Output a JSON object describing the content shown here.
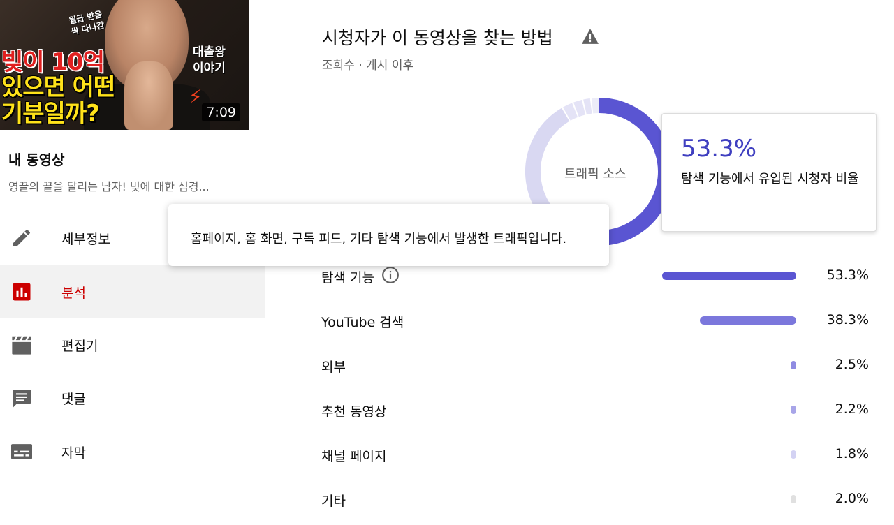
{
  "sidebar": {
    "thumbnail": {
      "overlay_red": "빚이 10억",
      "overlay_yellow_1": "있으면 어떤",
      "overlay_yellow_2": "기분일까?",
      "overlay_side": "대출왕\n이야기",
      "overlay_small": "월급 받음\n싹 다나감",
      "duration": "7:09"
    },
    "video_title": "내 동영상",
    "video_desc": "영끌의 끝을 달리는 남자! 빚에 대한 심경...",
    "nav": [
      {
        "label": "세부정보",
        "icon": "pencil-icon",
        "active": false
      },
      {
        "label": "분석",
        "icon": "analytics-icon",
        "active": true
      },
      {
        "label": "편집기",
        "icon": "clapperboard-icon",
        "active": false
      },
      {
        "label": "댓글",
        "icon": "comment-icon",
        "active": false
      },
      {
        "label": "자막",
        "icon": "subtitles-icon",
        "active": false
      }
    ]
  },
  "main": {
    "title": "시청자가 이 동영상을 찾는 방법",
    "subtitle": "조회수 · 게시 이후",
    "donut_label": "트래픽 소스",
    "tooltip": "홈페이지, 홈 화면, 구독 피드, 기타 탐색 기능에서 발생한 트래픽입니다.",
    "card": {
      "value": "53.3%",
      "desc": "탐색 기능에서 유입된 시청자 비율"
    },
    "colors": {
      "accent": "#5a55d2",
      "accent_2": "#7b77dc",
      "donut_rest": "#d9d8f2",
      "red_active": "#cc0000"
    },
    "rows": [
      {
        "label": "탐색 기능",
        "value": "53.3%",
        "pct": 53.3,
        "info": true
      },
      {
        "label": "YouTube 검색",
        "value": "38.3%",
        "pct": 38.3,
        "info": false
      },
      {
        "label": "외부",
        "value": "2.5%",
        "pct": 2.5,
        "info": false
      },
      {
        "label": "추천 동영상",
        "value": "2.2%",
        "pct": 2.2,
        "info": false
      },
      {
        "label": "채널 페이지",
        "value": "1.8%",
        "pct": 1.8,
        "info": false
      },
      {
        "label": "기타",
        "value": "2.0%",
        "pct": 2.0,
        "info": false
      }
    ]
  }
}
